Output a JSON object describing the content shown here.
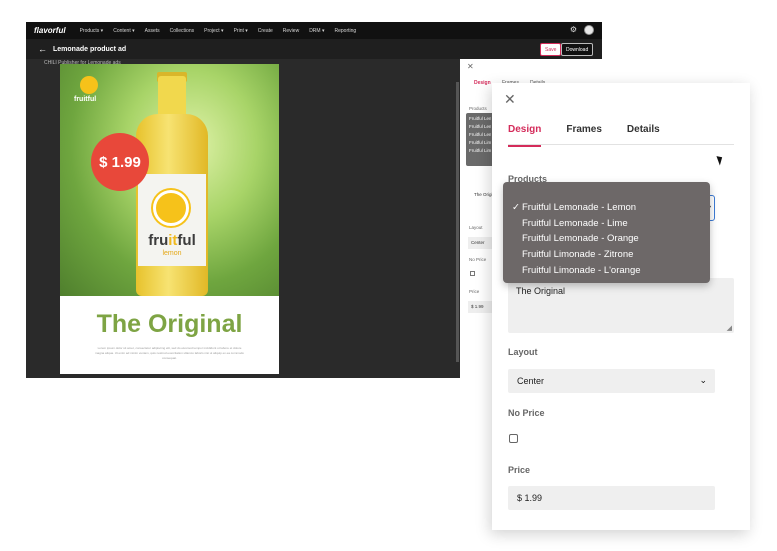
{
  "app": {
    "brand": "flavorful",
    "nav": [
      "Products ▾",
      "Content ▾",
      "Assets",
      "Collections",
      "Project ▾",
      "Print ▾",
      "Create",
      "Review",
      "DRM ▾",
      "Reporting"
    ],
    "page_title": "Lemonade product ad",
    "save_label": "Save",
    "download_label": "Download",
    "breadcrumb": "CHILI Publisher for Lemonade ads"
  },
  "ad": {
    "logo_text": "fruitful",
    "price_badge": "$ 1.99",
    "bottle_brand_a": "fru",
    "bottle_brand_b": "it",
    "bottle_brand_c": "ful",
    "bottle_flavor": "lemon",
    "headline": "The Original",
    "body_text": "Lorem ipsum dolor sit amet, consectetur adipiscing elit, sed do eiusmod tempor incididunt ut labore et dolore magna aliqua. Ut enim ad minim veniam, quis nostrud exercitation ullamco laboris nisi ut aliquip ex ea commodo consequat."
  },
  "side_small": {
    "tabs": [
      "Design",
      "Frames",
      "Details"
    ],
    "products_label": "Products",
    "items": [
      "Fruitful Lemonade - Lemon",
      "Fruitful Lemonade - Lime",
      "Fruitful Lemonade - Orange",
      "Fruitful Limonade - Zitrone",
      "Fruitful Limonade - L'orange"
    ],
    "text_value": "The Original",
    "layout_label": "Layout",
    "layout_value": "Center",
    "noprice_label": "No Price",
    "price_label": "Price",
    "price_value": "$ 1.99"
  },
  "panel": {
    "tabs": {
      "design": "Design",
      "frames": "Frames",
      "details": "Details"
    },
    "products_label": "Products",
    "product_options": [
      "Fruitful Lemonade - Lemon",
      "Fruitful Lemonade - Lime",
      "Fruitful Lemonade - Orange",
      "Fruitful Limonade - Zitrone",
      "Fruitful Limonade - L'orange"
    ],
    "selected_check": "✓",
    "text_value": "The Original",
    "layout_label": "Layout",
    "layout_value": "Center",
    "noprice_label": "No Price",
    "price_label": "Price",
    "price_value": "$ 1.99"
  },
  "colors": {
    "accent": "#d42b5a",
    "dropdown_bg": "#6d6868",
    "headline_green": "#7ea444"
  }
}
